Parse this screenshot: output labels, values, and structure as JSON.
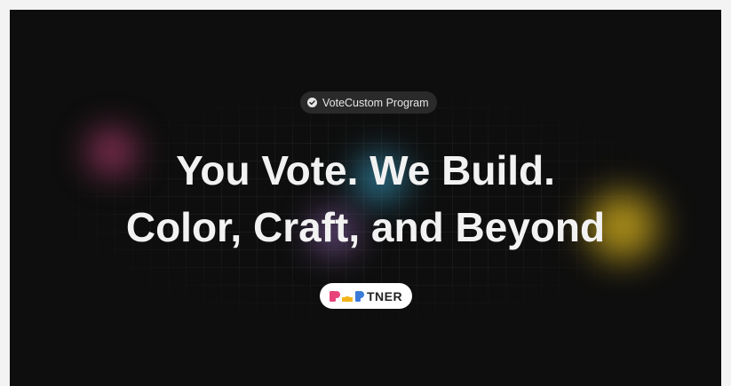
{
  "badge": {
    "icon": "check-circle-icon",
    "label": "VoteCustom Program"
  },
  "headline": {
    "line1": "You Vote. We Build.",
    "line2": "Color, Craft, and Beyond"
  },
  "logo": {
    "text": "TNER",
    "mark_colors": [
      "#e8447a",
      "#f2b51d",
      "#3b7bd9"
    ]
  },
  "colors": {
    "background": "#0e0e0e",
    "glow_pink": "#d64682",
    "glow_cyan": "#3caad2",
    "glow_purple": "#aa78d2",
    "glow_yellow": "#e6be1e"
  }
}
